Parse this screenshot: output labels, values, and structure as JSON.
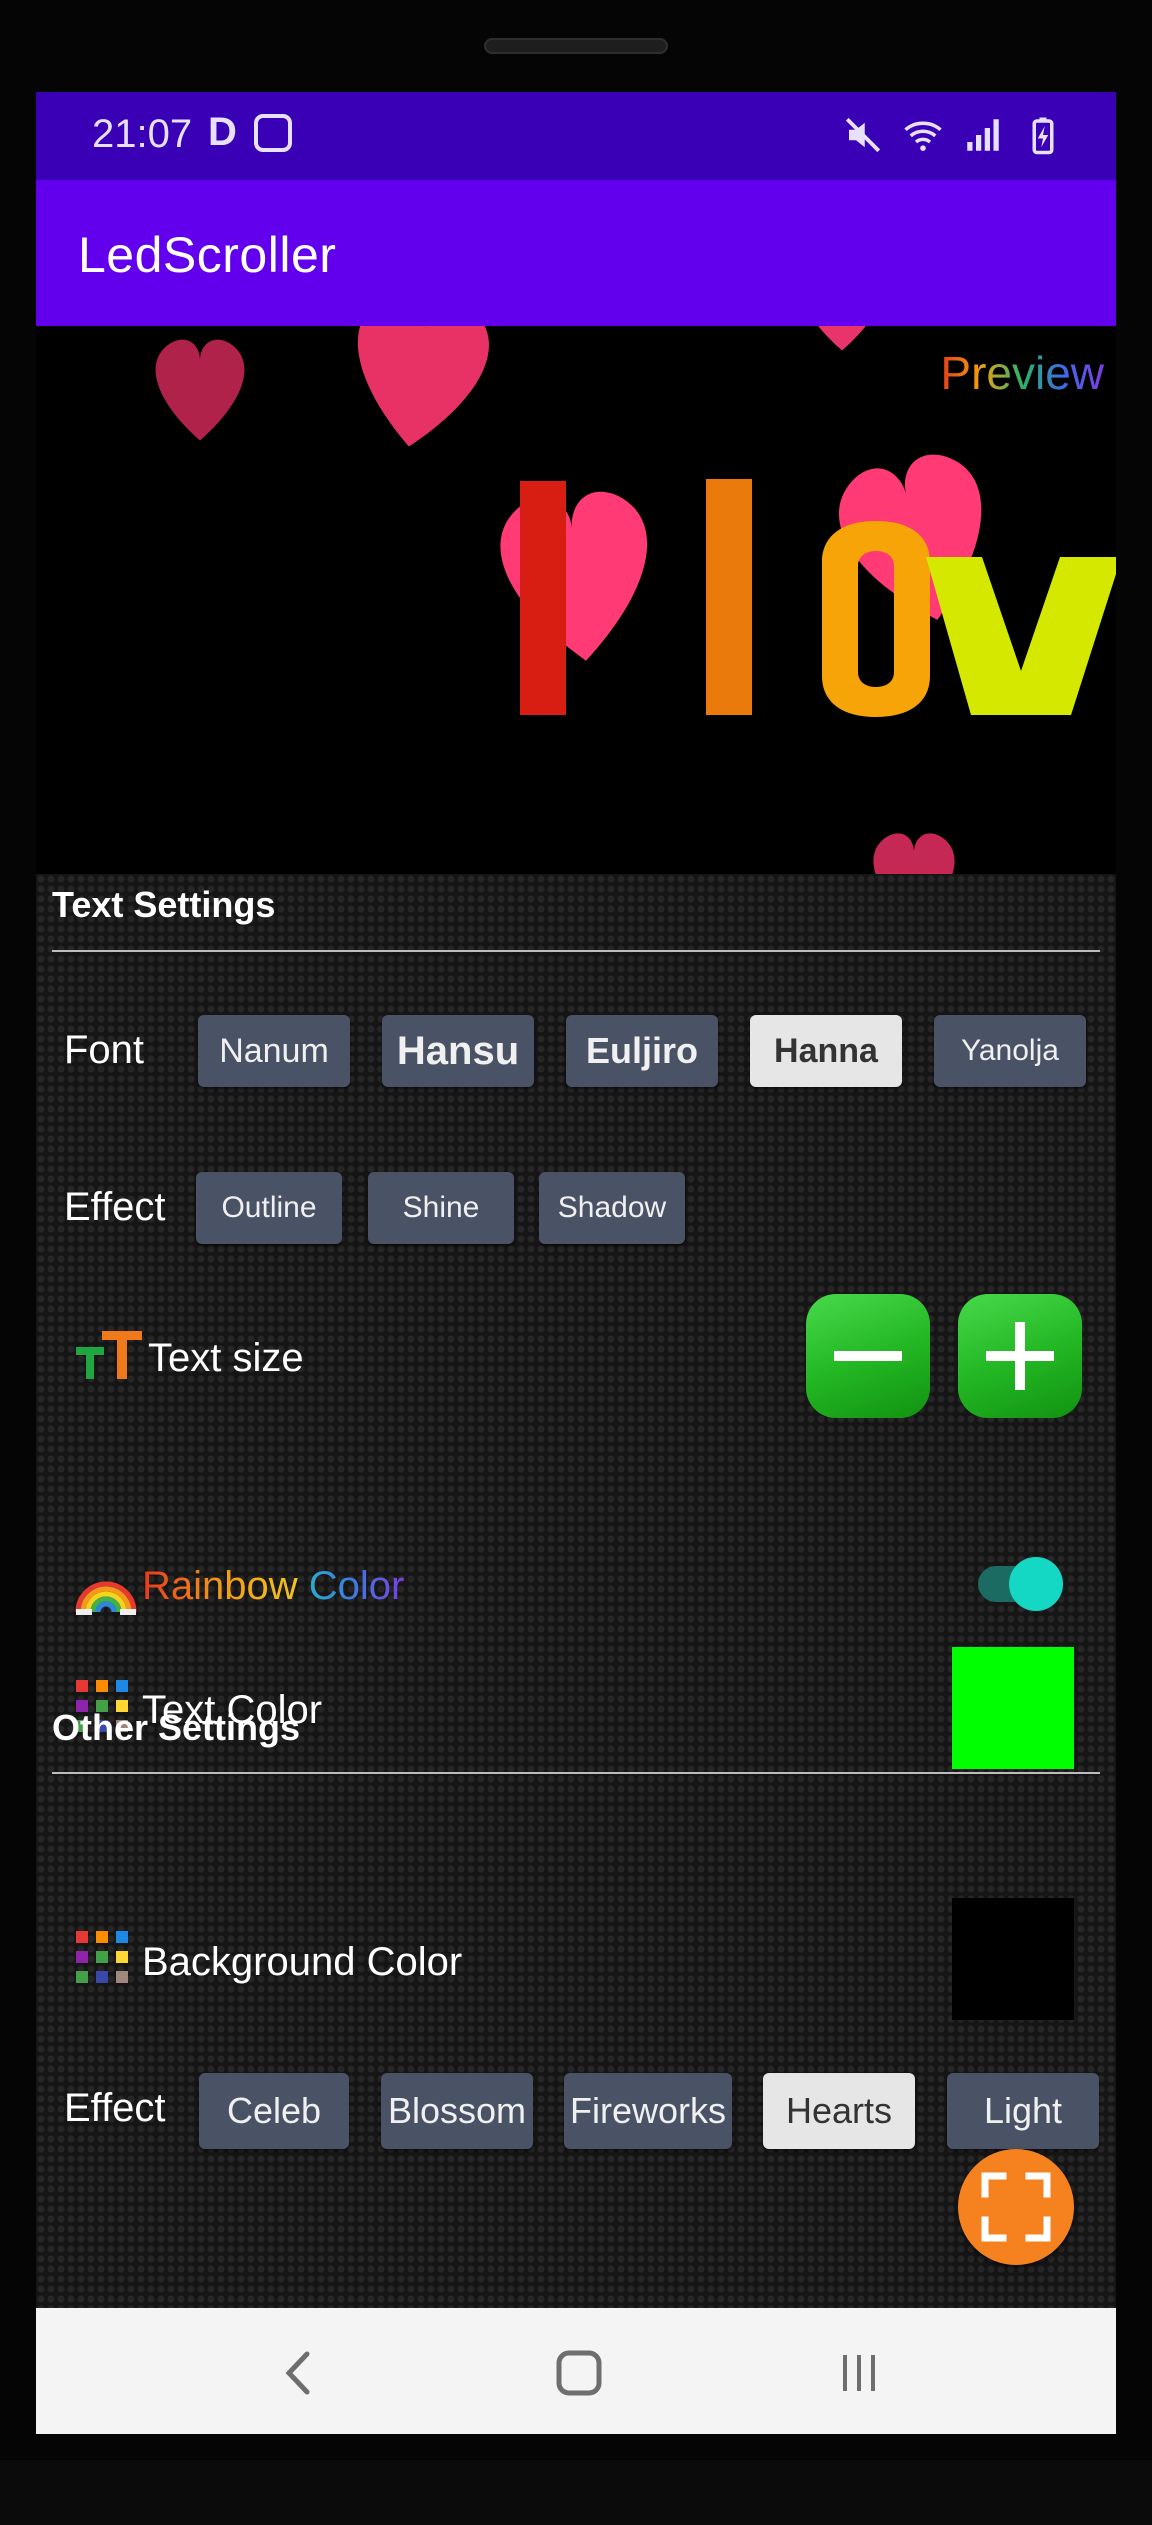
{
  "status_bar": {
    "time": "21:07",
    "indicator": "D",
    "icons": [
      "app-notification-icon",
      "mute-icon",
      "wifi-icon",
      "signal-icon",
      "battery-charging-icon"
    ]
  },
  "app_bar": {
    "title": "LedScroller"
  },
  "preview": {
    "label": "Preview",
    "scroll_text": "I lov",
    "background_effect": "hearts-icon"
  },
  "text_settings": {
    "title": "Text Settings",
    "font": {
      "label": "Font",
      "options": [
        "Nanum",
        "Hansu",
        "Euljiro",
        "Hanna",
        "Yanolja"
      ],
      "selected": "Hanna"
    },
    "effect": {
      "label": "Effect",
      "options": [
        "Outline",
        "Shine",
        "Shadow"
      ]
    },
    "text_size": {
      "label": "Text size",
      "icon": "text-size-icon",
      "decrease_icon": "minus-icon",
      "increase_icon": "plus-icon"
    },
    "rainbow_color": {
      "label_part1": "Rainbow",
      "label_part2": " Color",
      "icon": "rainbow-icon",
      "enabled": true
    },
    "text_color": {
      "label": "Text Color",
      "icon": "palette-grid-icon",
      "value": "#00ff00"
    }
  },
  "other_settings": {
    "title": "Other Settings",
    "background_color": {
      "label": "Background Color",
      "icon": "palette-grid-icon",
      "value": "#000000"
    },
    "effect": {
      "label": "Effect",
      "options": [
        "Celeb",
        "Blossom",
        "Fireworks",
        "Hearts",
        "Light"
      ],
      "selected": "Hearts"
    }
  },
  "fab": {
    "icon": "fullscreen-icon"
  },
  "nav_bar": {
    "icons": [
      "back-icon",
      "home-icon",
      "recents-icon"
    ]
  },
  "colors": {
    "status_bar": "#3a00b5",
    "app_bar": "#6200ee",
    "chip": "#4a5266",
    "chip_selected": "#e6e6e6",
    "fab": "#f6821f",
    "button_green": "#22b522",
    "toggle": "#14d8c4"
  }
}
